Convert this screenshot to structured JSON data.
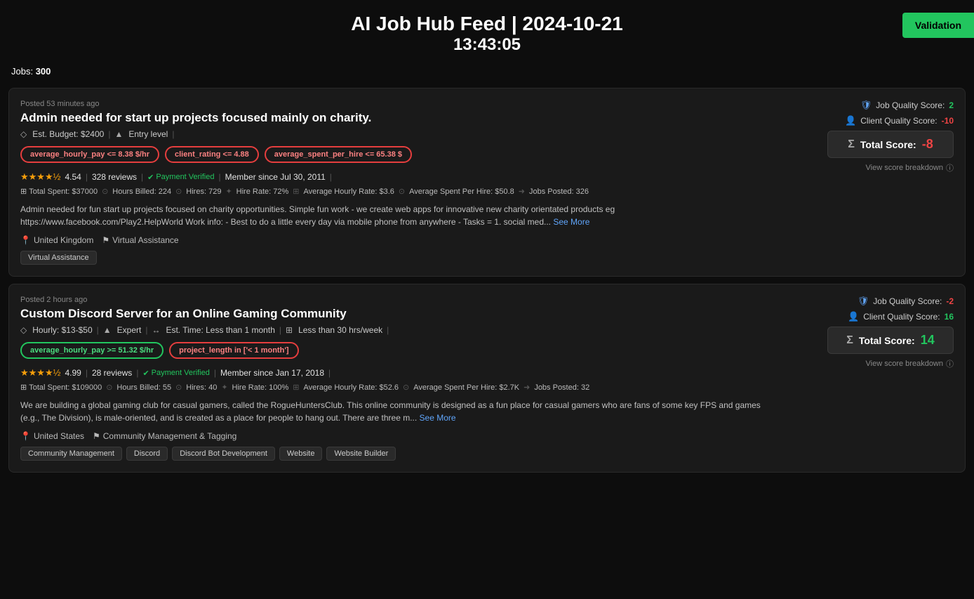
{
  "header": {
    "title": "AI Job Hub Feed | 2024-10-21",
    "subtitle": "13:43:05",
    "validation_button": "Validation"
  },
  "jobs_count_label": "Jobs:",
  "jobs_count": "300",
  "jobs": [
    {
      "posted": "Posted 53 minutes ago",
      "title": "Admin needed for start up projects focused mainly on charity.",
      "budget_label": "Est. Budget: $2400",
      "level": "Entry level",
      "badges": [
        {
          "label": "average_hourly_pay <= 8.38 $/hr",
          "type": "red"
        },
        {
          "label": "client_rating <= 4.88",
          "type": "red"
        },
        {
          "label": "average_spent_per_hire <= 65.38 $",
          "type": "red"
        }
      ],
      "rating": "4.54",
      "reviews": "328 reviews",
      "payment_verified": "Payment Verified",
      "member_since": "Member since Jul 30, 2011",
      "total_spent": "Total Spent: $37000",
      "hours_billed": "Hours Billed: 224",
      "hires": "Hires: 729",
      "hire_rate": "Hire Rate: 72%",
      "avg_hourly": "Average Hourly Rate: $3.6",
      "avg_spent_per_hire": "Average Spent Per Hire: $50.8",
      "jobs_posted": "Jobs Posted: 326",
      "description": "Admin needed for fun start up projects focused on charity opportunities. Simple fun work - we create web apps for innovative new charity orientated products eg https://www.facebook.com/Play2.HelpWorld Work info: - Best to do a little every day via mobile phone from anywhere - Tasks = 1. social med...",
      "see_more": "See More",
      "location": "United Kingdom",
      "category": "Virtual Assistance",
      "tags": [
        "Virtual Assistance"
      ],
      "job_quality_score_label": "Job Quality Score:",
      "job_quality_score": "2",
      "job_quality_score_type": "positive",
      "client_quality_score_label": "Client Quality Score:",
      "client_quality_score": "-10",
      "client_quality_score_type": "negative",
      "total_score_label": "Total Score:",
      "total_score": "-8",
      "total_score_type": "negative",
      "view_breakdown": "View score breakdown"
    },
    {
      "posted": "Posted 2 hours ago",
      "title": "Custom Discord Server for an Online Gaming Community",
      "hourly_label": "Hourly: $13-$50",
      "level": "Expert",
      "est_time": "Est. Time: Less than 1 month",
      "hours_per_week": "Less than 30 hrs/week",
      "badges": [
        {
          "label": "average_hourly_pay >= 51.32 $/hr",
          "type": "green"
        },
        {
          "label": "project_length in ['< 1 month']",
          "type": "red"
        }
      ],
      "rating": "4.99",
      "reviews": "28 reviews",
      "payment_verified": "Payment Verified",
      "member_since": "Member since Jan 17, 2018",
      "total_spent": "Total Spent: $109000",
      "hours_billed": "Hours Billed: 55",
      "hires": "Hires: 40",
      "hire_rate": "Hire Rate: 100%",
      "avg_hourly": "Average Hourly Rate: $52.6",
      "avg_spent_per_hire": "Average Spent Per Hire: $2.7K",
      "jobs_posted": "Jobs Posted: 32",
      "description": "We are building a global gaming club for casual gamers, called the RogueHuntersClub. This online community is designed as a fun place for casual gamers who are fans of some key FPS and games (e.g., The Division), is male-oriented, and is created as a place for people to hang out. There are three m...",
      "see_more": "See More",
      "location": "United States",
      "category": "Community Management & Tagging",
      "tags": [
        "Community Management",
        "Discord",
        "Discord Bot Development",
        "Website",
        "Website Builder"
      ],
      "job_quality_score_label": "Job Quality Score:",
      "job_quality_score": "-2",
      "job_quality_score_type": "negative",
      "client_quality_score_label": "Client Quality Score:",
      "client_quality_score": "16",
      "client_quality_score_type": "positive",
      "total_score_label": "Total Score:",
      "total_score": "14",
      "total_score_type": "positive",
      "view_breakdown": "View score breakdown"
    }
  ]
}
